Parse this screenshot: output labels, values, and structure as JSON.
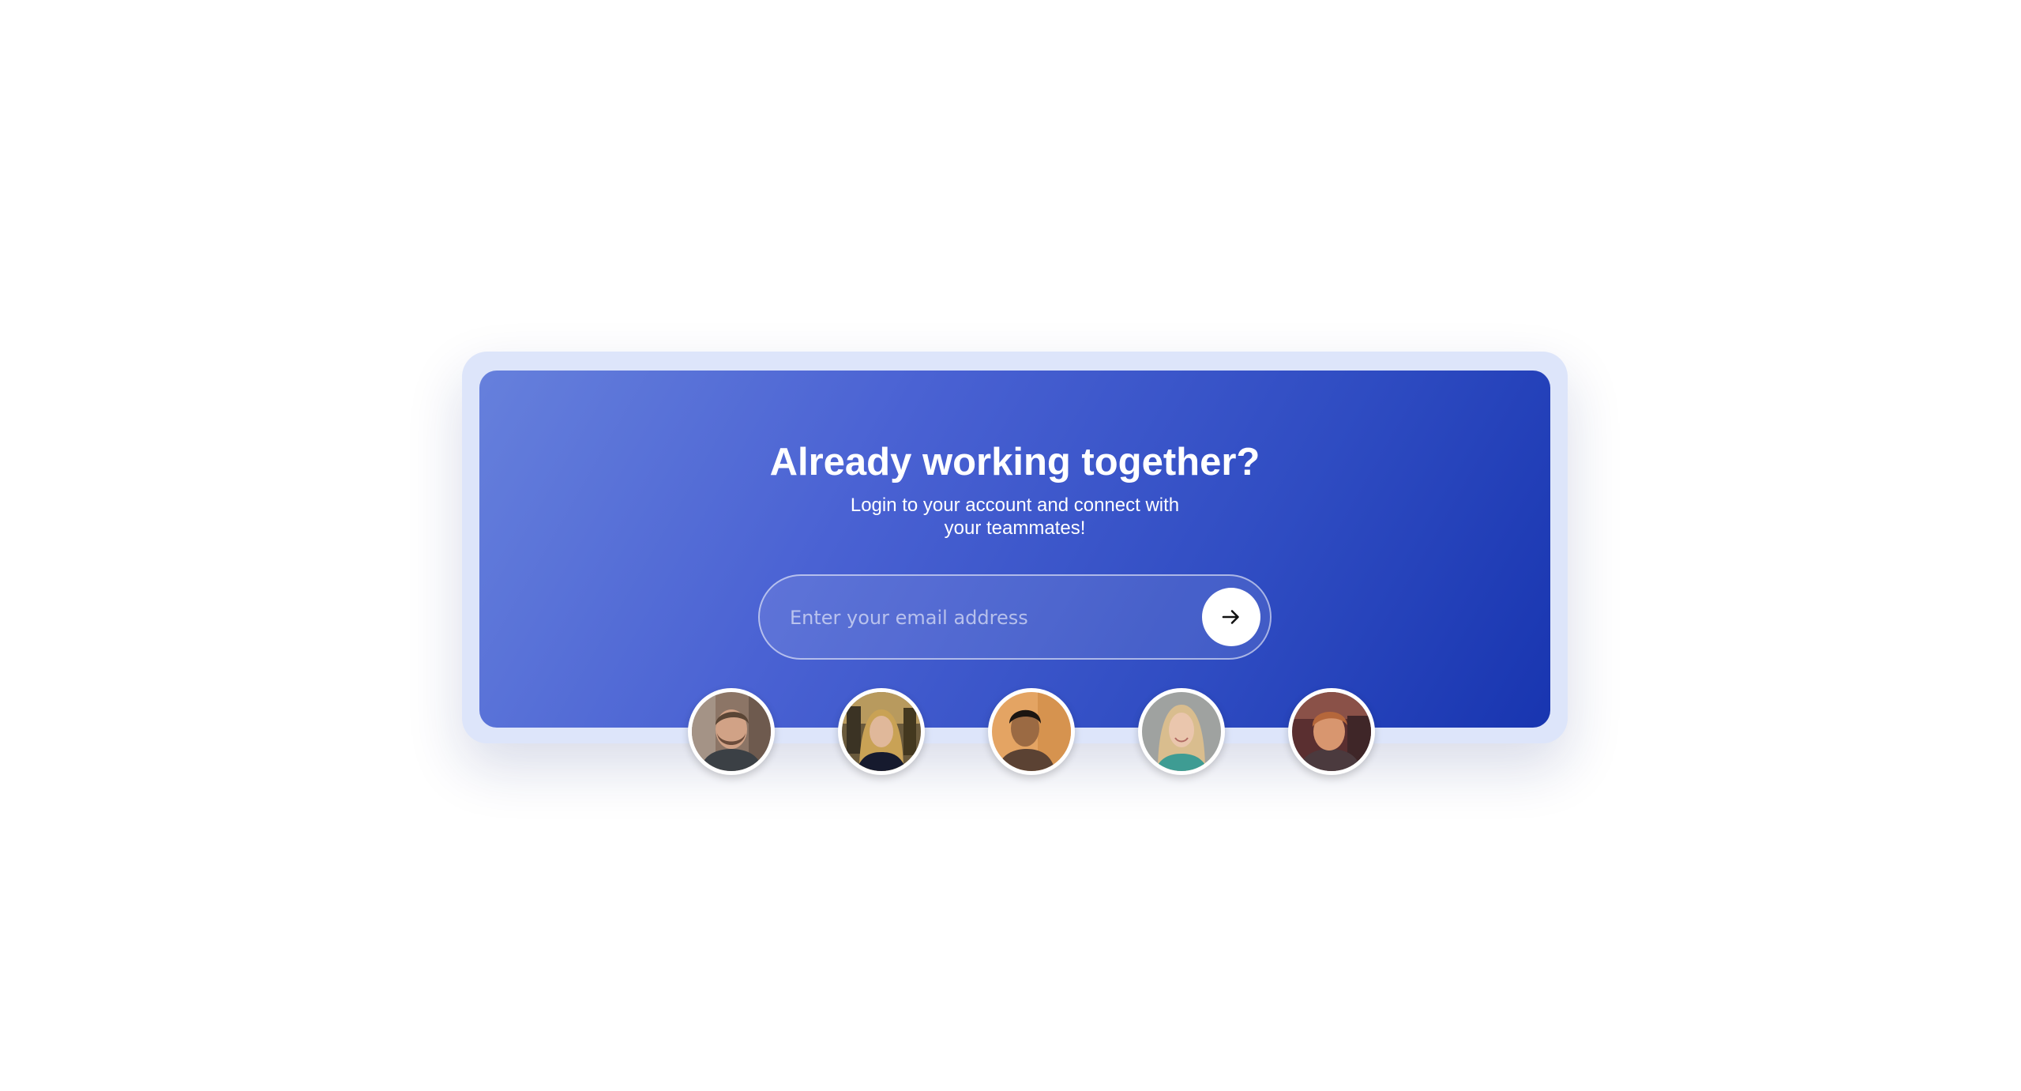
{
  "card": {
    "title": "Already working together?",
    "subtitle": "Login to your account and connect with your teammates!"
  },
  "email": {
    "placeholder": "Enter your email address",
    "value": ""
  },
  "submit": {
    "icon": "arrow-right-icon"
  },
  "avatars": [
    {
      "name": "avatar-1",
      "icon": "man-beard-photo"
    },
    {
      "name": "avatar-2",
      "icon": "woman-blonde-photo"
    },
    {
      "name": "avatar-3",
      "icon": "man-dark-hair-photo"
    },
    {
      "name": "avatar-4",
      "icon": "woman-blonde-photo"
    },
    {
      "name": "avatar-5",
      "icon": "man-red-hair-photo"
    }
  ],
  "colors": {
    "gradient_start": "#6680dc",
    "gradient_end": "#1835b0",
    "frame": "#dde5fa",
    "text": "#ffffff"
  }
}
